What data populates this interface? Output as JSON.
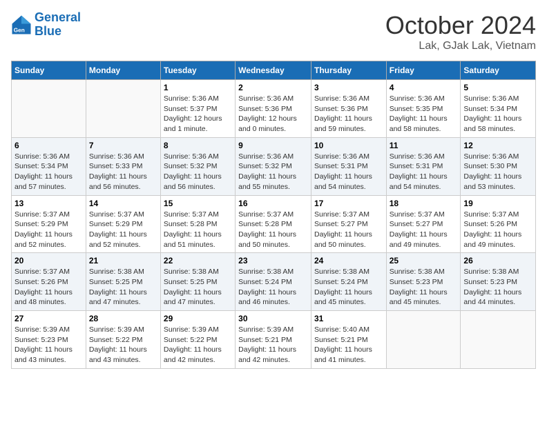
{
  "logo": {
    "line1": "General",
    "line2": "Blue"
  },
  "title": "October 2024",
  "subtitle": "Lak, GJak Lak, Vietnam",
  "weekdays": [
    "Sunday",
    "Monday",
    "Tuesday",
    "Wednesday",
    "Thursday",
    "Friday",
    "Saturday"
  ],
  "weeks": [
    [
      {
        "day": "",
        "details": ""
      },
      {
        "day": "",
        "details": ""
      },
      {
        "day": "1",
        "details": "Sunrise: 5:36 AM\nSunset: 5:37 PM\nDaylight: 12 hours and 1 minute."
      },
      {
        "day": "2",
        "details": "Sunrise: 5:36 AM\nSunset: 5:36 PM\nDaylight: 12 hours and 0 minutes."
      },
      {
        "day": "3",
        "details": "Sunrise: 5:36 AM\nSunset: 5:36 PM\nDaylight: 11 hours and 59 minutes."
      },
      {
        "day": "4",
        "details": "Sunrise: 5:36 AM\nSunset: 5:35 PM\nDaylight: 11 hours and 58 minutes."
      },
      {
        "day": "5",
        "details": "Sunrise: 5:36 AM\nSunset: 5:34 PM\nDaylight: 11 hours and 58 minutes."
      }
    ],
    [
      {
        "day": "6",
        "details": "Sunrise: 5:36 AM\nSunset: 5:34 PM\nDaylight: 11 hours and 57 minutes."
      },
      {
        "day": "7",
        "details": "Sunrise: 5:36 AM\nSunset: 5:33 PM\nDaylight: 11 hours and 56 minutes."
      },
      {
        "day": "8",
        "details": "Sunrise: 5:36 AM\nSunset: 5:32 PM\nDaylight: 11 hours and 56 minutes."
      },
      {
        "day": "9",
        "details": "Sunrise: 5:36 AM\nSunset: 5:32 PM\nDaylight: 11 hours and 55 minutes."
      },
      {
        "day": "10",
        "details": "Sunrise: 5:36 AM\nSunset: 5:31 PM\nDaylight: 11 hours and 54 minutes."
      },
      {
        "day": "11",
        "details": "Sunrise: 5:36 AM\nSunset: 5:31 PM\nDaylight: 11 hours and 54 minutes."
      },
      {
        "day": "12",
        "details": "Sunrise: 5:36 AM\nSunset: 5:30 PM\nDaylight: 11 hours and 53 minutes."
      }
    ],
    [
      {
        "day": "13",
        "details": "Sunrise: 5:37 AM\nSunset: 5:29 PM\nDaylight: 11 hours and 52 minutes."
      },
      {
        "day": "14",
        "details": "Sunrise: 5:37 AM\nSunset: 5:29 PM\nDaylight: 11 hours and 52 minutes."
      },
      {
        "day": "15",
        "details": "Sunrise: 5:37 AM\nSunset: 5:28 PM\nDaylight: 11 hours and 51 minutes."
      },
      {
        "day": "16",
        "details": "Sunrise: 5:37 AM\nSunset: 5:28 PM\nDaylight: 11 hours and 50 minutes."
      },
      {
        "day": "17",
        "details": "Sunrise: 5:37 AM\nSunset: 5:27 PM\nDaylight: 11 hours and 50 minutes."
      },
      {
        "day": "18",
        "details": "Sunrise: 5:37 AM\nSunset: 5:27 PM\nDaylight: 11 hours and 49 minutes."
      },
      {
        "day": "19",
        "details": "Sunrise: 5:37 AM\nSunset: 5:26 PM\nDaylight: 11 hours and 49 minutes."
      }
    ],
    [
      {
        "day": "20",
        "details": "Sunrise: 5:37 AM\nSunset: 5:26 PM\nDaylight: 11 hours and 48 minutes."
      },
      {
        "day": "21",
        "details": "Sunrise: 5:38 AM\nSunset: 5:25 PM\nDaylight: 11 hours and 47 minutes."
      },
      {
        "day": "22",
        "details": "Sunrise: 5:38 AM\nSunset: 5:25 PM\nDaylight: 11 hours and 47 minutes."
      },
      {
        "day": "23",
        "details": "Sunrise: 5:38 AM\nSunset: 5:24 PM\nDaylight: 11 hours and 46 minutes."
      },
      {
        "day": "24",
        "details": "Sunrise: 5:38 AM\nSunset: 5:24 PM\nDaylight: 11 hours and 45 minutes."
      },
      {
        "day": "25",
        "details": "Sunrise: 5:38 AM\nSunset: 5:23 PM\nDaylight: 11 hours and 45 minutes."
      },
      {
        "day": "26",
        "details": "Sunrise: 5:38 AM\nSunset: 5:23 PM\nDaylight: 11 hours and 44 minutes."
      }
    ],
    [
      {
        "day": "27",
        "details": "Sunrise: 5:39 AM\nSunset: 5:23 PM\nDaylight: 11 hours and 43 minutes."
      },
      {
        "day": "28",
        "details": "Sunrise: 5:39 AM\nSunset: 5:22 PM\nDaylight: 11 hours and 43 minutes."
      },
      {
        "day": "29",
        "details": "Sunrise: 5:39 AM\nSunset: 5:22 PM\nDaylight: 11 hours and 42 minutes."
      },
      {
        "day": "30",
        "details": "Sunrise: 5:39 AM\nSunset: 5:21 PM\nDaylight: 11 hours and 42 minutes."
      },
      {
        "day": "31",
        "details": "Sunrise: 5:40 AM\nSunset: 5:21 PM\nDaylight: 11 hours and 41 minutes."
      },
      {
        "day": "",
        "details": ""
      },
      {
        "day": "",
        "details": ""
      }
    ]
  ]
}
